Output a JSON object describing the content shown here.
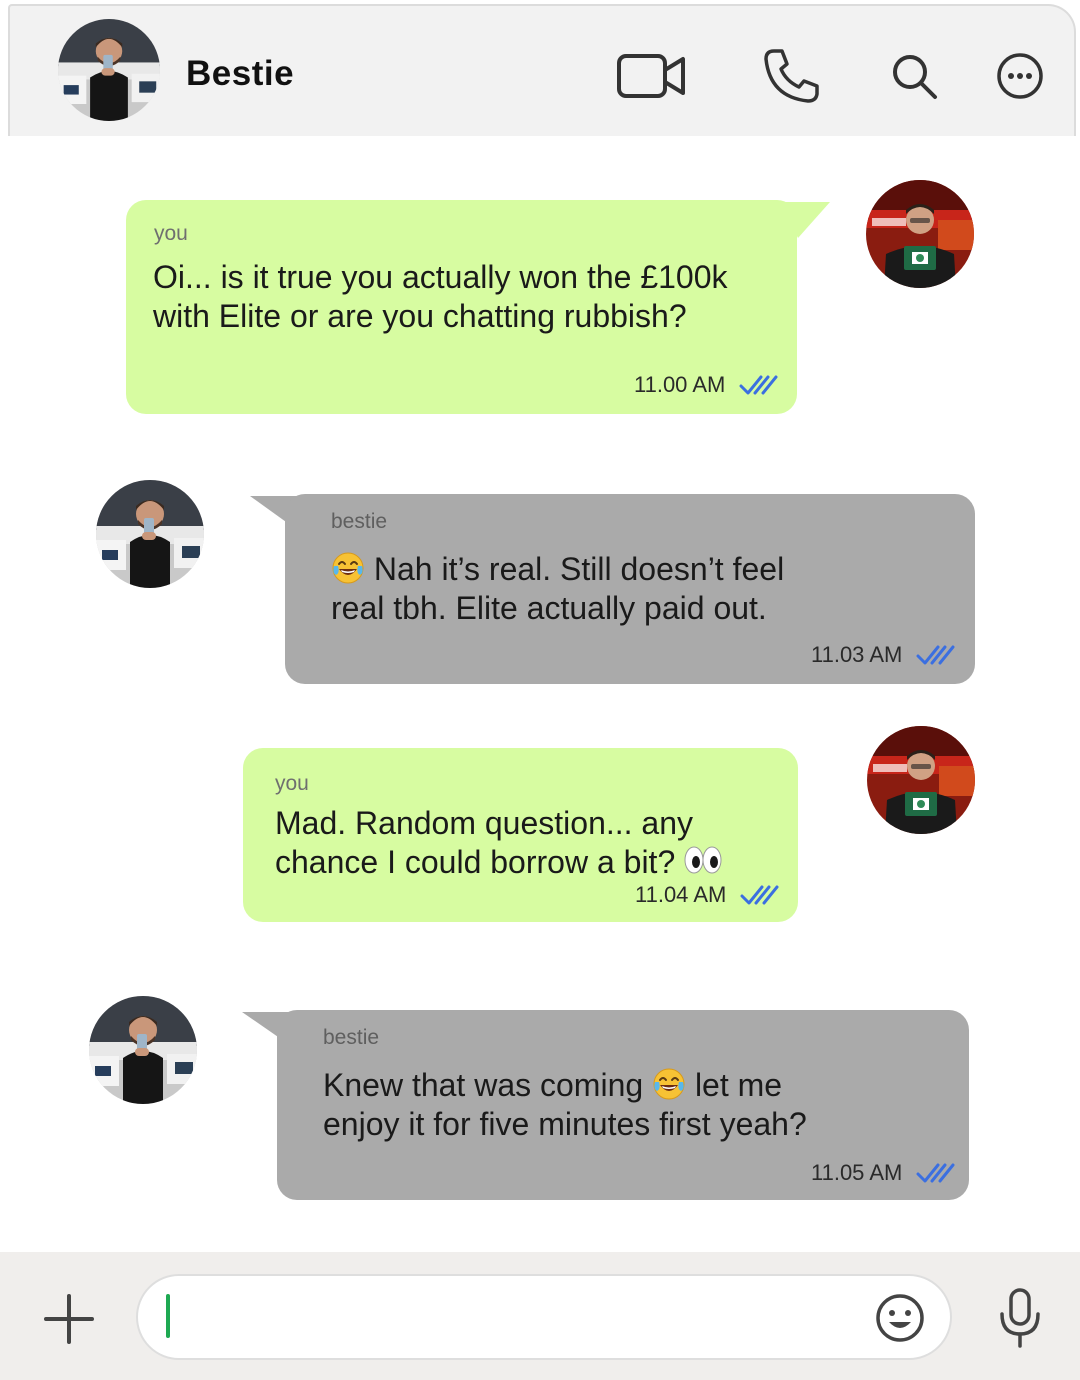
{
  "header": {
    "contact_name": "Bestie",
    "icons": [
      "video-call-icon",
      "phone-call-icon",
      "search-icon",
      "more-options-icon"
    ]
  },
  "messages": [
    {
      "direction": "sent",
      "sender": "you",
      "text_lines": [
        "Oi... is it true you actually won the £100k",
        "with Elite or are you chatting rubbish?"
      ],
      "time": "11.00 AM",
      "status": "read"
    },
    {
      "direction": "received",
      "sender": "bestie",
      "text_lines": [
        "Nah it’s real. Still doesn’t feel",
        "real tbh. Elite actually paid out."
      ],
      "leading_emoji": "face-with-tears-of-joy",
      "time": "11.03 AM",
      "status": "read"
    },
    {
      "direction": "sent",
      "sender": "you",
      "text_lines": [
        "Mad. Random question... any",
        "chance I could borrow a bit?"
      ],
      "trailing_emoji": "eyes",
      "time": "11.04 AM",
      "status": "read"
    },
    {
      "direction": "received",
      "sender": "bestie",
      "text_lines": [
        "Knew that was coming",
        "let me",
        "enjoy it for five minutes first yeah?"
      ],
      "inline_emoji": "face-with-tears-of-joy",
      "time": "11.05 AM",
      "status": "read"
    }
  ],
  "composer": {
    "input_value": "",
    "placeholder": "",
    "icons": [
      "plus-icon",
      "emoji-icon",
      "microphone-icon"
    ]
  },
  "colors": {
    "header_bg": "#f2f2f2",
    "sent_bubble": "#d7fca1",
    "received_bubble": "#aaaaaa",
    "read_ticks": "#3b6fe0",
    "caret": "#1ea952",
    "composer_bg": "#f0eeec"
  }
}
